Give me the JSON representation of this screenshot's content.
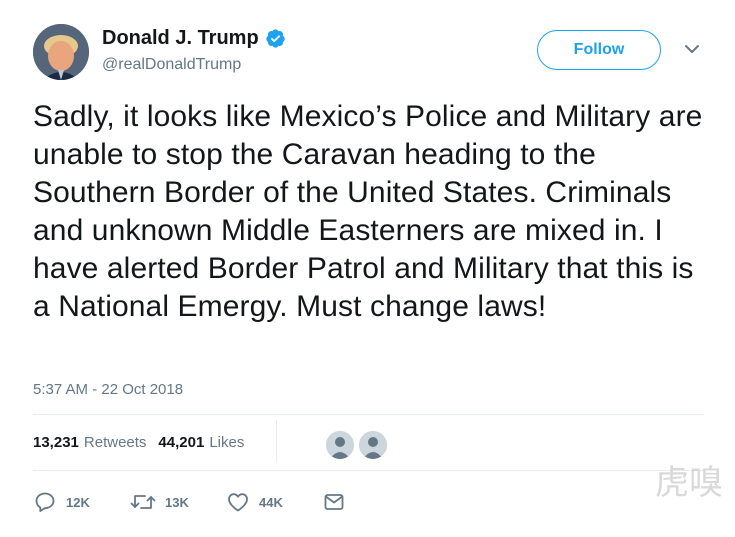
{
  "author": {
    "display_name": "Donald J. Trump",
    "handle": "@realDonaldTrump",
    "verified": true
  },
  "follow_label": "Follow",
  "tweet": {
    "text": "Sadly, it looks like Mexico’s Police and Military are unable to stop the Caravan heading to the Southern Border of the United States. Criminals and unknown Middle Easterners are mixed in. I have alerted Border Patrol and Military that this is a National Emergy. Must change laws!",
    "timestamp": "5:37 AM - 22 Oct 2018"
  },
  "stats": {
    "retweets_count": "13,231",
    "retweets_label": "Retweets",
    "likes_count": "44,201",
    "likes_label": "Likes"
  },
  "actions": {
    "reply_count": "12K",
    "retweet_count": "13K",
    "like_count": "44K"
  },
  "watermark": "虎嗅",
  "colors": {
    "accent": "#1da1f2",
    "text": "#14171a",
    "muted": "#657786",
    "divider": "#e6ecf0"
  }
}
